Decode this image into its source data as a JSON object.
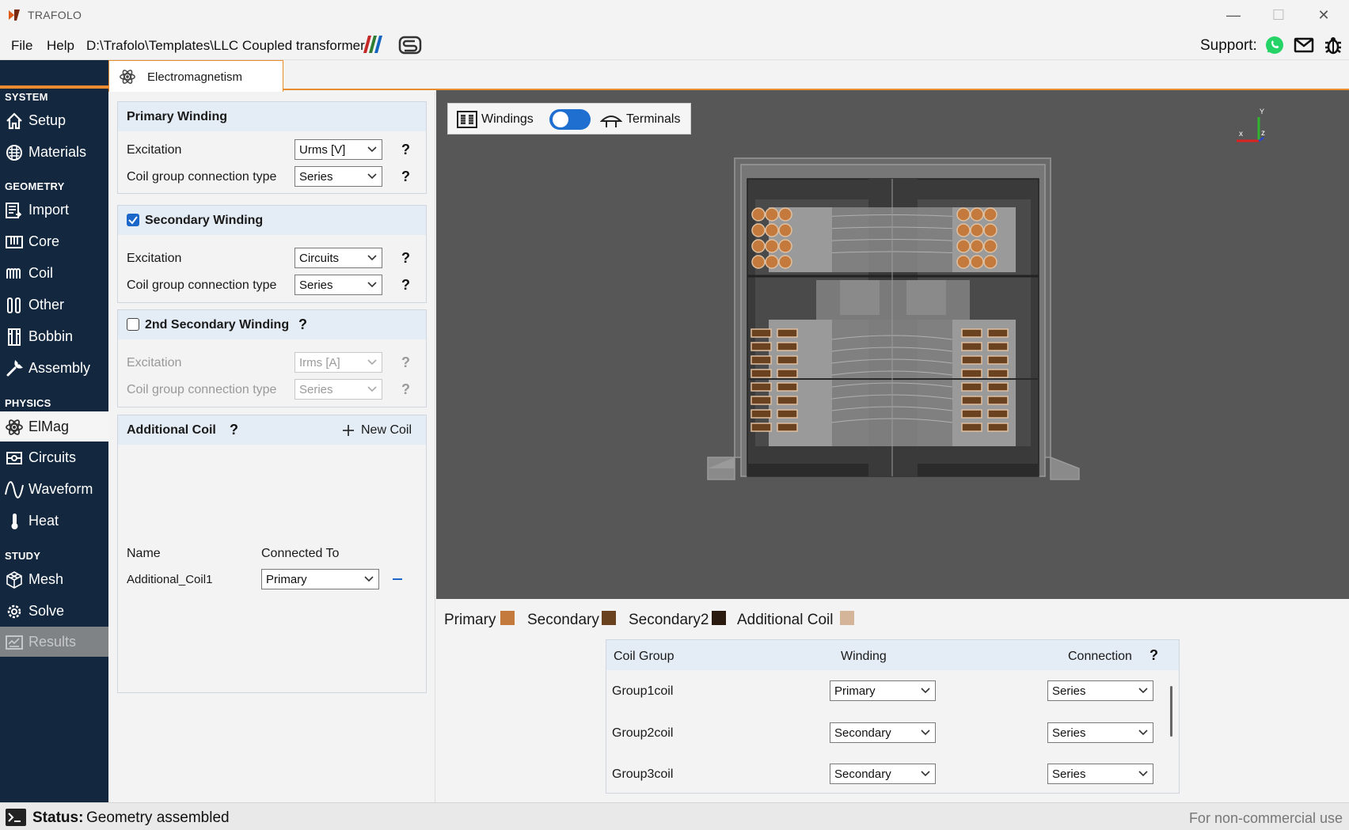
{
  "window": {
    "title": "TRAFOLO"
  },
  "menu": {
    "file": "File",
    "help": "Help",
    "path": "D:\\Trafolo\\Templates\\LLC Coupled transformer"
  },
  "support": {
    "label": "Support:",
    "icons": [
      "whatsapp-icon",
      "mail-icon",
      "bug-icon"
    ]
  },
  "sidebar": {
    "sections": {
      "system": "SYSTEM",
      "geometry": "GEOMETRY",
      "physics": "PHYSICS",
      "study": "STUDY"
    },
    "items": {
      "setup": "Setup",
      "materials": "Materials",
      "import": "Import",
      "core": "Core",
      "coil": "Coil",
      "other": "Other",
      "bobbin": "Bobbin",
      "assembly": "Assembly",
      "elmag": "ElMag",
      "circuits": "Circuits",
      "waveform": "Waveform",
      "heat": "Heat",
      "mesh": "Mesh",
      "solve": "Solve",
      "results": "Results"
    },
    "active": "ElMag"
  },
  "tab": {
    "label": "Electromagnetism"
  },
  "primary": {
    "title": "Primary Winding",
    "excitation_label": "Excitation",
    "excitation_value": "Urms [V]",
    "connection_label": "Coil group connection type",
    "connection_value": "Series",
    "help": "?"
  },
  "secondary": {
    "title": "Secondary Winding",
    "checked": true,
    "excitation_label": "Excitation",
    "excitation_value": "Circuits",
    "connection_label": "Coil group connection type",
    "connection_value": "Series",
    "help": "?"
  },
  "secondary2": {
    "title": "2nd Secondary Winding",
    "checked": false,
    "excitation_label": "Excitation",
    "excitation_value": "Irms [A]",
    "connection_label": "Coil group connection type",
    "connection_value": "Series",
    "help": "?"
  },
  "additional": {
    "title": "Additional Coil",
    "help": "?",
    "new_coil": "New Coil",
    "col_name": "Name",
    "col_connected": "Connected To",
    "rows": [
      {
        "name": "Additional_Coil1",
        "connected": "Primary"
      }
    ]
  },
  "viewport": {
    "windings_label": "Windings",
    "terminals_label": "Terminals",
    "toggle_on": true,
    "axis_x": "x",
    "axis_y": "Y",
    "axis_z": "z"
  },
  "legend": [
    {
      "label": "Primary",
      "color": "#c47a3c"
    },
    {
      "label": "Secondary",
      "color": "#6b4220"
    },
    {
      "label": "Secondary2",
      "color": "#2a1a10"
    },
    {
      "label": "Additional Coil",
      "color": "#d4b59a"
    }
  ],
  "coil_table": {
    "headers": {
      "group": "Coil Group",
      "winding": "Winding",
      "connection": "Connection",
      "help": "?"
    },
    "rows": [
      {
        "group": "Group1coil",
        "winding": "Primary",
        "connection": "Series"
      },
      {
        "group": "Group2coil",
        "winding": "Secondary",
        "connection": "Series"
      },
      {
        "group": "Group3coil",
        "winding": "Secondary",
        "connection": "Series"
      }
    ]
  },
  "status": {
    "key": "Status:",
    "value": "Geometry assembled",
    "note": "For non-commercial use"
  },
  "colors": {
    "accent": "#e98b2e",
    "sidebar": "#13273e",
    "toggle": "#1f6fd1",
    "viewport": "#575757"
  }
}
